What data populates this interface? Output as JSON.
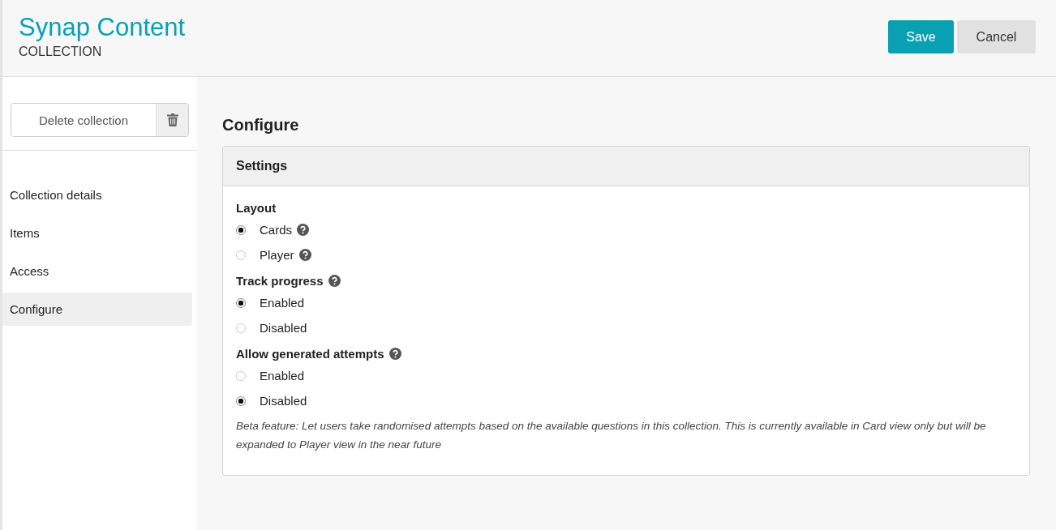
{
  "header": {
    "title": "Synap Content",
    "subtitle": "COLLECTION",
    "buttons": [
      {
        "label": "Save",
        "kind": "primary"
      },
      {
        "label": "Cancel",
        "kind": "secondary"
      }
    ]
  },
  "sidebar": {
    "delete_button": "Delete collection",
    "items": [
      {
        "label": "Collection details",
        "selected": false
      },
      {
        "label": "Items",
        "selected": false
      },
      {
        "label": "Access",
        "selected": false
      },
      {
        "label": "Configure",
        "selected": true
      }
    ]
  },
  "main": {
    "heading": "Configure",
    "panel": {
      "title": "Settings",
      "groups": [
        {
          "label": "Layout",
          "help": false,
          "options": [
            {
              "label": "Cards",
              "selected": true,
              "help": true
            },
            {
              "label": "Player",
              "selected": false,
              "help": true
            }
          ]
        },
        {
          "label": "Track progress",
          "help": true,
          "options": [
            {
              "label": "Enabled",
              "selected": true,
              "help": false
            },
            {
              "label": "Disabled",
              "selected": false,
              "help": false
            }
          ]
        },
        {
          "label": "Allow generated attempts",
          "help": true,
          "options": [
            {
              "label": "Enabled",
              "selected": false,
              "help": false
            },
            {
              "label": "Disabled",
              "selected": true,
              "help": false
            }
          ],
          "note": "Beta feature: Let users take randomised attempts based on the available questions in this collection. This is currently available in Card view only but will be expanded to Player view in the near future"
        }
      ]
    }
  }
}
